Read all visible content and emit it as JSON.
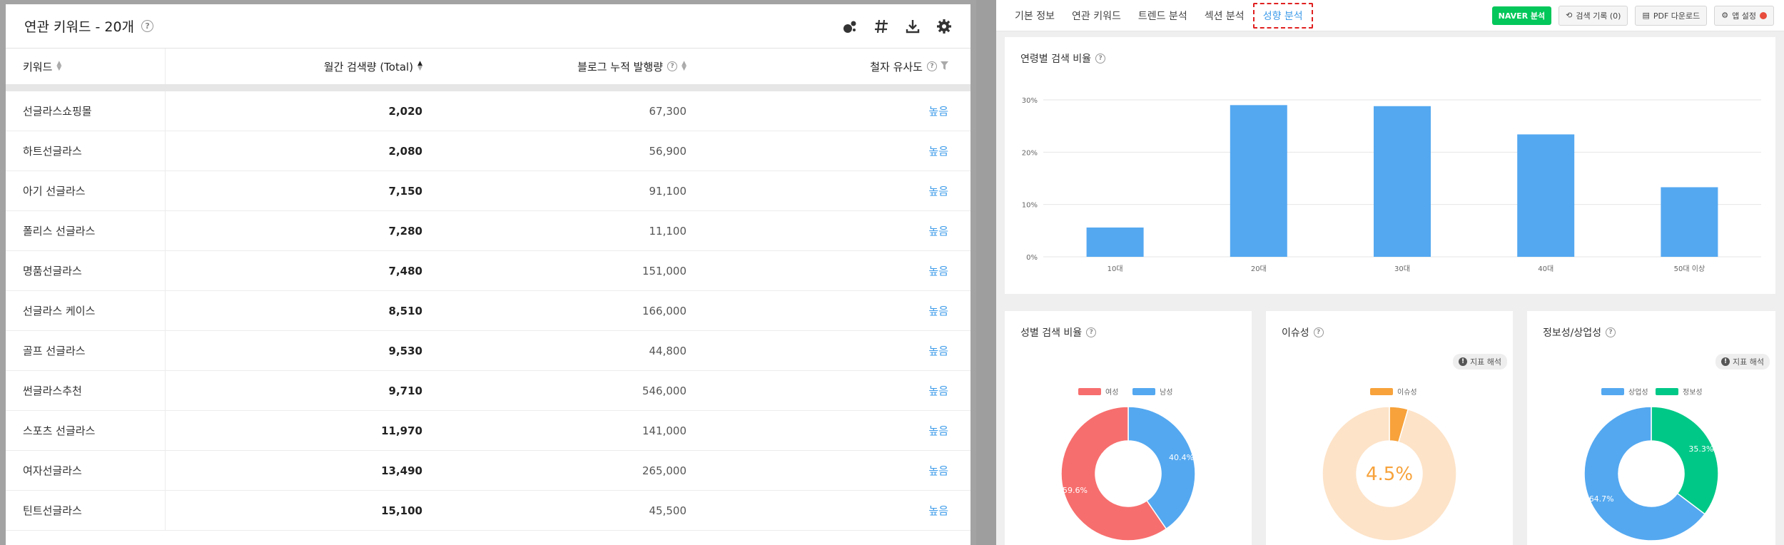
{
  "left": {
    "title": "연관 키워드 - 20개",
    "columns": {
      "keyword": "키워드",
      "monthly": "월간 검색량 (Total)",
      "blog": "블로그 누적 발행량",
      "similarity": "철자 유사도"
    },
    "rows": [
      {
        "keyword": "선글라스쇼핑몰",
        "monthly": "2,020",
        "blog": "67,300",
        "similarity": "높음"
      },
      {
        "keyword": "하트선글라스",
        "monthly": "2,080",
        "blog": "56,900",
        "similarity": "높음"
      },
      {
        "keyword": "아기 선글라스",
        "monthly": "7,150",
        "blog": "91,100",
        "similarity": "높음"
      },
      {
        "keyword": "폴리스 선글라스",
        "monthly": "7,280",
        "blog": "11,100",
        "similarity": "높음"
      },
      {
        "keyword": "명품선글라스",
        "monthly": "7,480",
        "blog": "151,000",
        "similarity": "높음"
      },
      {
        "keyword": "선글라스 케이스",
        "monthly": "8,510",
        "blog": "166,000",
        "similarity": "높음"
      },
      {
        "keyword": "골프 선글라스",
        "monthly": "9,530",
        "blog": "44,800",
        "similarity": "높음"
      },
      {
        "keyword": "썬글라스추천",
        "monthly": "9,710",
        "blog": "546,000",
        "similarity": "높음"
      },
      {
        "keyword": "스포츠 선글라스",
        "monthly": "11,970",
        "blog": "141,000",
        "similarity": "높음"
      },
      {
        "keyword": "여자선글라스",
        "monthly": "13,490",
        "blog": "265,000",
        "similarity": "높음"
      },
      {
        "keyword": "틴트선글라스",
        "monthly": "15,100",
        "blog": "45,500",
        "similarity": "높음"
      }
    ]
  },
  "right": {
    "tabs": [
      "기본 정보",
      "연관 키워드",
      "트렌드 분석",
      "섹션 분석",
      "성향 분석"
    ],
    "active_tab": "성향 분석",
    "actions": {
      "naver": "NAVER 분석",
      "history": "검색 기록 (0)",
      "pdf": "PDF 다운로드",
      "settings": "앱 설정"
    },
    "interpret_label": "지표 해석",
    "age_card_title": "연령별 검색 비율",
    "gender_card_title": "성별 검색 비율",
    "issue_card_title": "이슈성",
    "info_card_title": "정보성/상업성"
  },
  "colors": {
    "blue": "#54a8f0",
    "red": "#f76e6e",
    "orange": "#f7a23b",
    "peach": "#fde3c8",
    "green": "#00c887",
    "accent": "#3d9be9"
  },
  "chart_data": [
    {
      "type": "bar",
      "title": "연령별 검색 비율",
      "categories": [
        "10대",
        "20대",
        "30대",
        "40대",
        "50대 이상"
      ],
      "values": [
        5.6,
        29.0,
        28.8,
        23.4,
        13.3
      ],
      "ylim": [
        0,
        30
      ],
      "yticks": [
        "0%",
        "10%",
        "20%",
        "30%"
      ],
      "grid": true
    },
    {
      "type": "pie",
      "title": "성별 검색 비율",
      "legend": [
        "여성",
        "남성"
      ],
      "values": [
        59.6,
        40.4
      ],
      "labels": [
        "59.6%",
        "40.4%"
      ],
      "donut": true
    },
    {
      "type": "pie",
      "title": "이슈성",
      "legend": [
        "이슈성"
      ],
      "values": [
        4.5
      ],
      "center_label": "4.5%",
      "donut": true
    },
    {
      "type": "pie",
      "title": "정보성/상업성",
      "legend": [
        "상업성",
        "정보성"
      ],
      "values": [
        64.7,
        35.3
      ],
      "labels": [
        "64.7%",
        "35.3%"
      ],
      "donut": true
    }
  ]
}
